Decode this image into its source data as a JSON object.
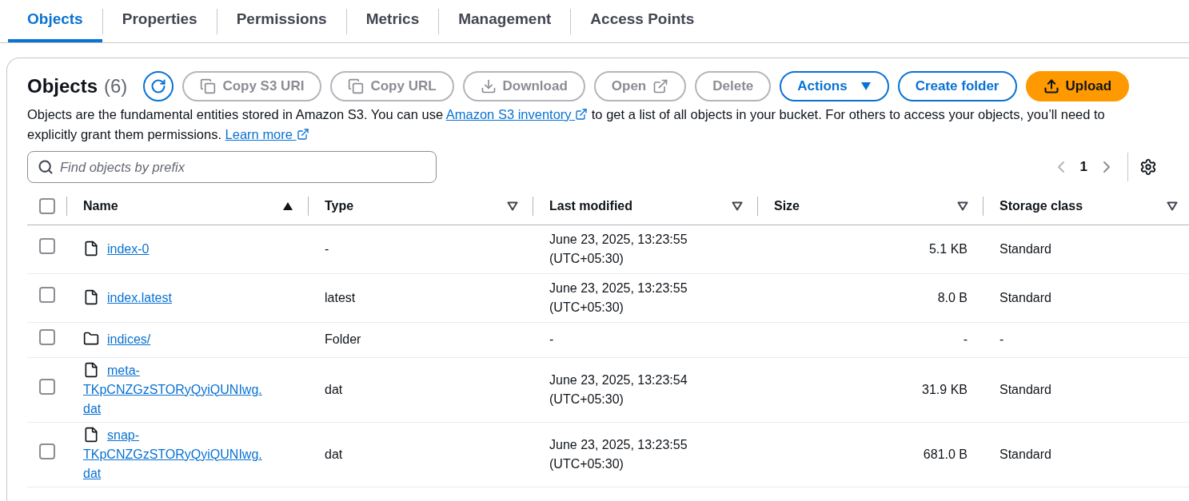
{
  "tabs": [
    {
      "label": "Objects",
      "selected": true
    },
    {
      "label": "Properties",
      "selected": false
    },
    {
      "label": "Permissions",
      "selected": false
    },
    {
      "label": "Metrics",
      "selected": false
    },
    {
      "label": "Management",
      "selected": false
    },
    {
      "label": "Access Points",
      "selected": false
    }
  ],
  "panel": {
    "title": "Objects",
    "count": "(6)",
    "buttons": [
      {
        "kind": "refresh",
        "disabled": false
      },
      {
        "kind": "normal",
        "label": "Copy S3 URI",
        "disabled": true
      },
      {
        "kind": "normal",
        "label": "Copy URL",
        "disabled": true
      },
      {
        "kind": "normal",
        "label": "Download",
        "disabled": true
      },
      {
        "kind": "normal",
        "label": "Open",
        "disabled": true
      },
      {
        "kind": "normal",
        "label": "Delete",
        "disabled": true
      },
      {
        "kind": "outline",
        "label": "Actions",
        "disabled": false
      },
      {
        "kind": "outline",
        "label": "Create folder",
        "disabled": false
      },
      {
        "kind": "primary",
        "label": "Upload",
        "disabled": false
      }
    ],
    "description": [
      {
        "kind": "text",
        "text": "Objects are the fundamental entities stored in Amazon S3. You can use "
      },
      {
        "kind": "link",
        "text": "Amazon S3 inventory"
      },
      {
        "kind": "text",
        "text": " to get a list of all objects in your bucket. For others to access your objects, you’ll need to explicitly grant them permissions. "
      },
      {
        "kind": "link",
        "text": "Learn more"
      }
    ],
    "search": {
      "placeholder": "Find objects by prefix"
    },
    "pagination": {
      "pages": [
        {
          "label": "1",
          "selected": true
        }
      ],
      "prev_disabled": true,
      "next_disabled": false
    }
  },
  "table": {
    "select_all": {
      "checked": false
    },
    "columns": [
      {
        "label": "Name",
        "sorted": true
      },
      {
        "label": "Type",
        "sorted": false
      },
      {
        "label": "Last modified",
        "sorted": false
      },
      {
        "label": "Size",
        "sorted": false
      },
      {
        "label": "Storage class",
        "sorted": false
      }
    ],
    "rows": [
      {
        "checked": false,
        "kind": "file",
        "name": "index-0",
        "type": "-",
        "modified": "June 23, 2025, 13:23:55 (UTC+05:30)",
        "size": "5.1 KB",
        "storage": "Standard"
      },
      {
        "checked": false,
        "kind": "file",
        "name": "index.latest",
        "type": "latest",
        "modified": "June 23, 2025, 13:23:55 (UTC+05:30)",
        "size": "8.0 B",
        "storage": "Standard"
      },
      {
        "checked": false,
        "kind": "folder",
        "name": "indices/",
        "type": "Folder",
        "modified": "-",
        "size": "-",
        "storage": "-"
      },
      {
        "checked": false,
        "kind": "file",
        "name": "meta-TKpCNZGzSTORyQyiQUNIwg.dat",
        "type": "dat",
        "modified": "June 23, 2025, 13:23:54 (UTC+05:30)",
        "size": "31.9 KB",
        "storage": "Standard"
      },
      {
        "checked": false,
        "kind": "file",
        "name": "snap-TKpCNZGzSTORyQyiQUNIwg.dat",
        "type": "dat",
        "modified": "June 23, 2025, 13:23:55 (UTC+05:30)",
        "size": "681.0 B",
        "storage": "Standard"
      }
    ]
  }
}
